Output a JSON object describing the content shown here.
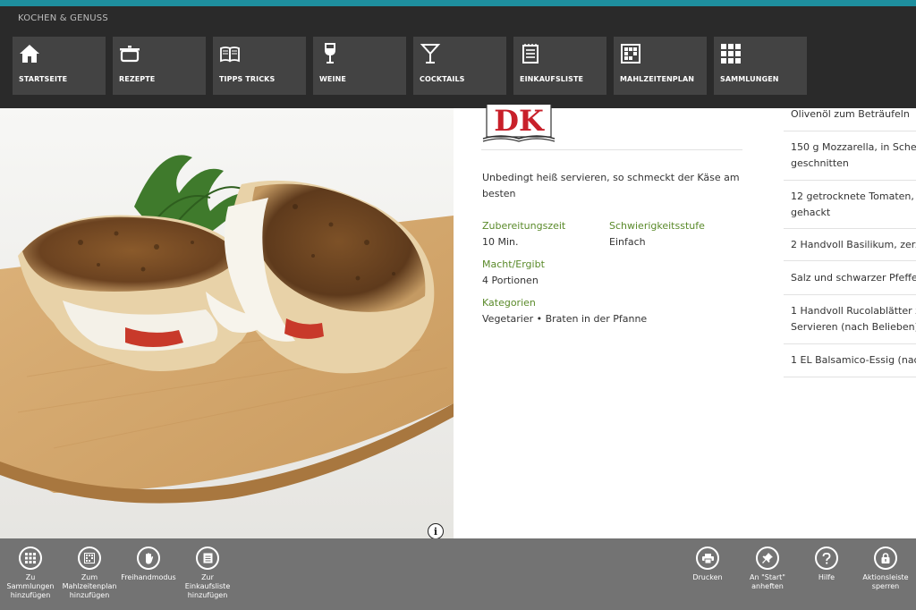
{
  "app": {
    "title": "KOCHEN & GENUSS"
  },
  "nav": [
    {
      "label": "STARTSEITE",
      "icon": "home-icon"
    },
    {
      "label": "REZEPTE",
      "icon": "cooking-pot-icon"
    },
    {
      "label": "TIPPS TRICKS",
      "icon": "book-icon"
    },
    {
      "label": "WEINE",
      "icon": "wine-glass-icon"
    },
    {
      "label": "COCKTAILS",
      "icon": "cocktail-glass-icon"
    },
    {
      "label": "EINKAUFSLISTE",
      "icon": "shopping-list-icon"
    },
    {
      "label": "MAHLZEITENPLAN",
      "icon": "meal-plan-grid-icon"
    },
    {
      "label": "SAMMLUNGEN",
      "icon": "collections-grid-icon"
    }
  ],
  "recipe": {
    "publisher_logo": "DK",
    "tagline": "Unbedingt heiß servieren, so schmeckt der Käse am besten",
    "prep_time_label": "Zubereitungszeit",
    "prep_time_value": "10 Min.",
    "difficulty_label": "Schwierigkeitsstufe",
    "difficulty_value": "Einfach",
    "yield_label": "Macht/Ergibt",
    "yield_value": "4 Portionen",
    "categories_label": "Kategorien",
    "categories_value": "Vegetarier • Braten in der Pfanne"
  },
  "ingredients": [
    "Olivenöl zum Beträufeln",
    "150 g Mozzarella, in Sche\ngeschnitten",
    "12 getrocknete Tomaten,\ngehackt",
    "2 Handvoll Basilikum, zerz",
    "Salz und schwarzer Pfeffe",
    "1 Handvoll Rucolablätter z\nServieren (nach Belieben)",
    "1 EL Balsamico-Essig (nac"
  ],
  "appbar": {
    "left": [
      {
        "label": "Zu\nSammlungen\nhinzufügen",
        "icon": "collections-add-icon"
      },
      {
        "label": "Zum\nMahlzeitenplan\nhinzufügen",
        "icon": "meal-plan-add-icon"
      },
      {
        "label": "Freihandmodus",
        "icon": "hand-icon"
      },
      {
        "label": "Zur\nEinkaufsliste\nhinzufügen",
        "icon": "shopping-list-add-icon"
      }
    ],
    "right": [
      {
        "label": "Drucken",
        "icon": "printer-icon"
      },
      {
        "label": "An \"Start\"\nanheften",
        "icon": "pin-icon"
      },
      {
        "label": "Hilfe",
        "icon": "help-icon"
      },
      {
        "label": "Aktionsleiste\nsperren",
        "icon": "lock-icon"
      }
    ]
  },
  "info_button": {
    "glyph": "i"
  },
  "colors": {
    "accent": "#1e8f9e",
    "top_bar": "#2a2a2a",
    "tile": "#434343",
    "app_bar": "#737373",
    "meta_label": "#5a8a2a"
  }
}
